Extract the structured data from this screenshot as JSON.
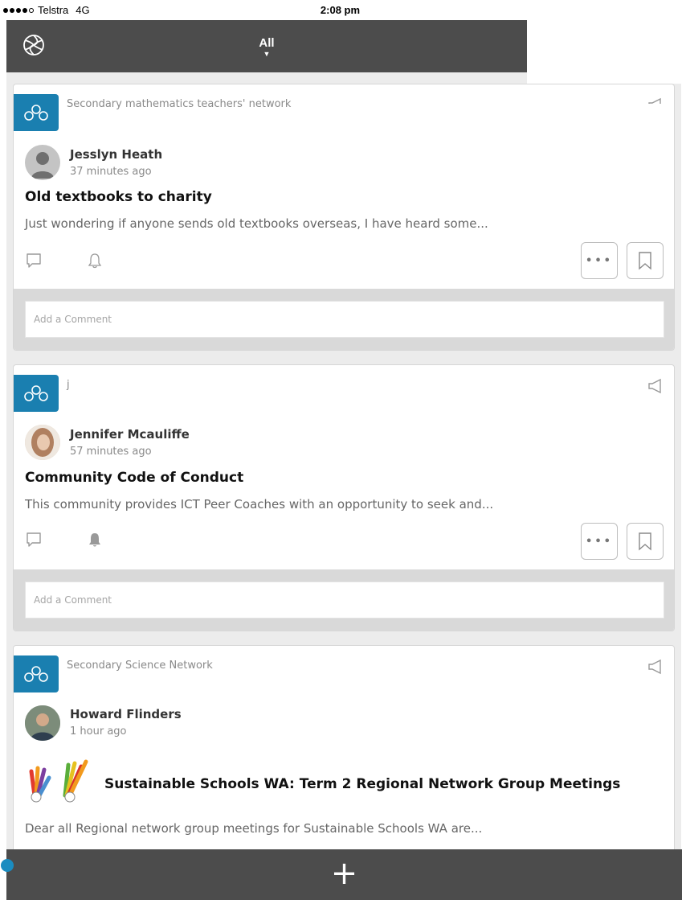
{
  "status_bar": {
    "carrier": "Telstra",
    "network": "4G",
    "time": "2:08 pm"
  },
  "nav": {
    "filter_label": "All",
    "filter_caret": "▼",
    "logo_icon": "app-logo-icon"
  },
  "posts": [
    {
      "community": "Secondary mathematics teachers' network",
      "author": "Jesslyn Heath",
      "time": "37 minutes ago",
      "title": "Old textbooks to charity",
      "excerpt": "Just wondering if anyone sends old textbooks overseas, I have heard some...",
      "comment_placeholder": "Add a Comment",
      "notify_active": false,
      "has_announcement_icon": false,
      "avatar": "default-avatar"
    },
    {
      "community": "j",
      "author": "Jennifer Mcauliffe",
      "time": "57 minutes ago",
      "title": "Community Code of Conduct",
      "excerpt": "This community provides ICT Peer Coaches with an opportunity to seek and...",
      "comment_placeholder": "Add a Comment",
      "notify_active": true,
      "has_announcement_icon": true,
      "avatar": "photo-avatar"
    },
    {
      "community": "Secondary Science Network",
      "author": "Howard Flinders",
      "time": "1 hour ago",
      "title": "Sustainable Schools WA: Term 2 Regional Network Group Meetings",
      "excerpt": "Dear all Regional network group meetings for Sustainable Schools WA are...",
      "has_announcement_icon": true,
      "avatar": "photo-avatar"
    }
  ],
  "bottom_bar": {
    "add_label": "+"
  },
  "colors": {
    "nav_bg": "#4c4c4c",
    "badge_blue": "#1a7fb0",
    "feed_bg": "#ececec",
    "comment_zone": "#d9d9d9"
  }
}
